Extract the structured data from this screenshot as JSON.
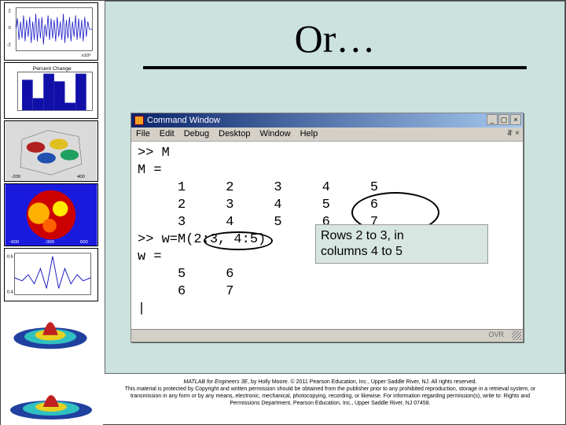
{
  "title": "Or…",
  "cmd": {
    "window_title": "Command Window",
    "menus": {
      "file": "File",
      "edit": "Edit",
      "debug": "Debug",
      "desktop": "Desktop",
      "window": "Window",
      "help": "Help"
    },
    "lines": {
      "l1": ">> M",
      "l2": "M =",
      "l3": "     1     2     3     4     5",
      "l4": "     2     3     4     5     6",
      "l5": "     3     4     5     6     7",
      "l6": ">> w=M(2:3, 4:5)",
      "l7": "w =",
      "l8": "     5     6",
      "l9": "     6     7"
    },
    "ovr": "OVR"
  },
  "callout": {
    "line1": "Rows 2 to 3, in",
    "line2": "columns 4 to 5"
  },
  "matrix_M": [
    [
      1,
      2,
      3,
      4,
      5
    ],
    [
      2,
      3,
      4,
      5,
      6
    ],
    [
      3,
      4,
      5,
      6,
      7
    ]
  ],
  "selection": {
    "rows": "2:3",
    "cols": "4:5"
  },
  "result_w": [
    [
      5,
      6
    ],
    [
      6,
      7
    ]
  ],
  "footer": {
    "book": "MATLAB for Engineers 3E",
    "rest1": ", by Holly Moore. © 2011 Pearson Education, Inc., Upper Saddle River, NJ. All rights reserved.",
    "line2": "This material is protected by Copyright and written permission should be obtained from the publisher prior to any prohibited reproduction, storage in a retrieval system, or",
    "line3": "transmission in any form or by any means, electronic, mechanical, photocopying, recording, or likewise. For information regarding permission(s), write to: Rights and",
    "line4": "Permissions Department, Pearson Education, Inc., Upper Saddle River, NJ 07458."
  },
  "thumbs": {
    "t2_label": "Percent Change"
  }
}
